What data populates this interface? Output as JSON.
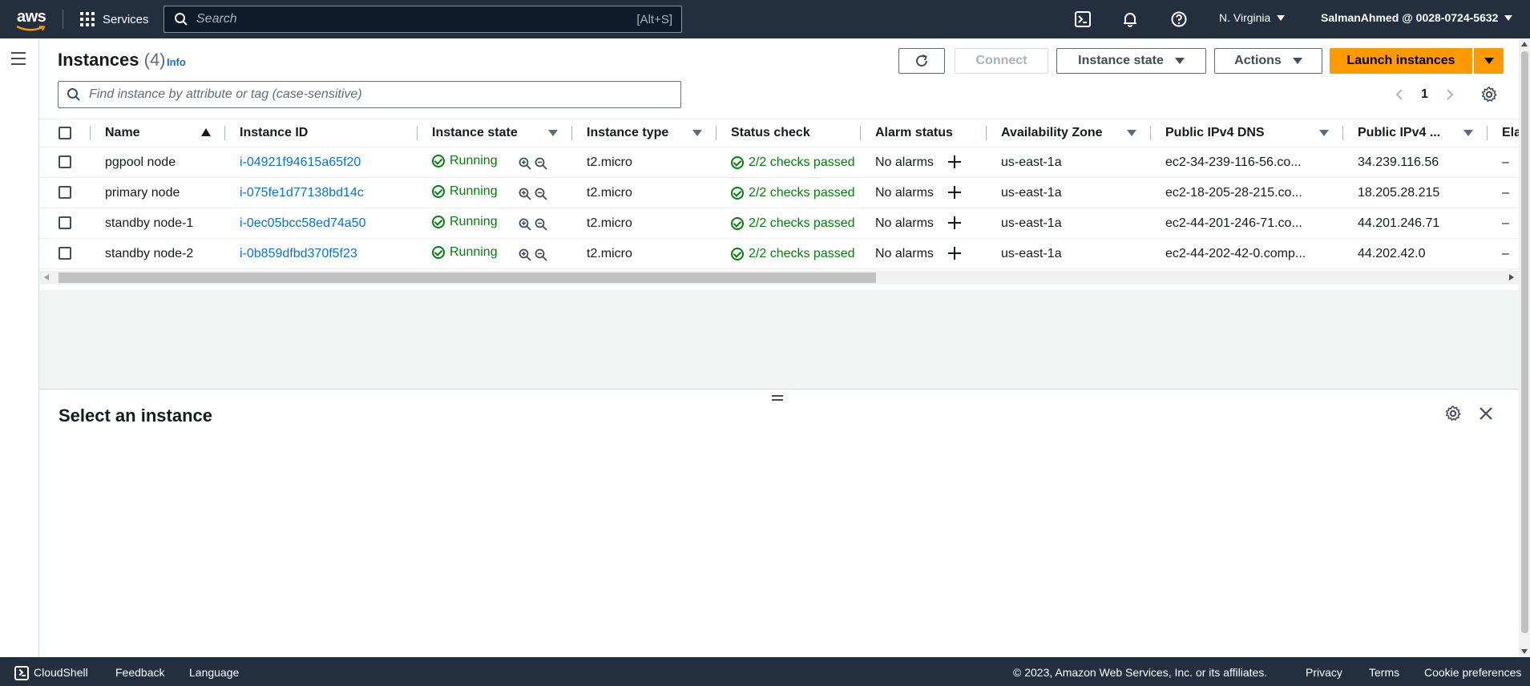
{
  "topnav": {
    "logo_text": "aws",
    "services_label": "Services",
    "search_placeholder": "Search",
    "search_shortcut": "[Alt+S]",
    "region": "N. Virginia",
    "account": "SalmanAhmed @ 0028-0724-5632"
  },
  "instances": {
    "title": "Instances",
    "count": "(4)",
    "info": "Info",
    "connect_label": "Connect",
    "instance_state_label": "Instance state",
    "actions_label": "Actions",
    "launch_label": "Launch instances",
    "filter_placeholder": "Find instance by attribute or tag (case-sensitive)",
    "page_number": "1"
  },
  "table": {
    "columns": [
      "Name",
      "Instance ID",
      "Instance state",
      "Instance type",
      "Status check",
      "Alarm status",
      "Availability Zone",
      "Public IPv4 DNS",
      "Public IPv4 ...",
      "Ela"
    ],
    "rows": [
      {
        "name": "pgpool node",
        "id": "i-04921f94615a65f20",
        "state": "Running",
        "type": "t2.micro",
        "status": "2/2 checks passed",
        "alarm": "No alarms",
        "az": "us-east-1a",
        "dns": "ec2-34-239-116-56.co...",
        "ip": "34.239.116.56",
        "ela": "–"
      },
      {
        "name": "primary node",
        "id": "i-075fe1d77138bd14c",
        "state": "Running",
        "type": "t2.micro",
        "status": "2/2 checks passed",
        "alarm": "No alarms",
        "az": "us-east-1a",
        "dns": "ec2-18-205-28-215.co...",
        "ip": "18.205.28.215",
        "ela": "–"
      },
      {
        "name": "standby node-1",
        "id": "i-0ec05bcc58ed74a50",
        "state": "Running",
        "type": "t2.micro",
        "status": "2/2 checks passed",
        "alarm": "No alarms",
        "az": "us-east-1a",
        "dns": "ec2-44-201-246-71.co...",
        "ip": "44.201.246.71",
        "ela": "–"
      },
      {
        "name": "standby node-2",
        "id": "i-0b859dfbd370f5f23",
        "state": "Running",
        "type": "t2.micro",
        "status": "2/2 checks passed",
        "alarm": "No alarms",
        "az": "us-east-1a",
        "dns": "ec2-44-202-42-0.comp...",
        "ip": "44.202.42.0",
        "ela": "–"
      }
    ]
  },
  "details": {
    "title": "Select an instance"
  },
  "footer": {
    "cloudshell": "CloudShell",
    "feedback": "Feedback",
    "language": "Language",
    "copyright": "© 2023, Amazon Web Services, Inc. or its affiliates.",
    "privacy": "Privacy",
    "terms": "Terms",
    "cookies": "Cookie preferences"
  },
  "colors": {
    "nav_bg": "#232f3e",
    "accent_orange": "#ff9900",
    "link_blue": "#0972d3",
    "success_green": "#037f0c"
  }
}
